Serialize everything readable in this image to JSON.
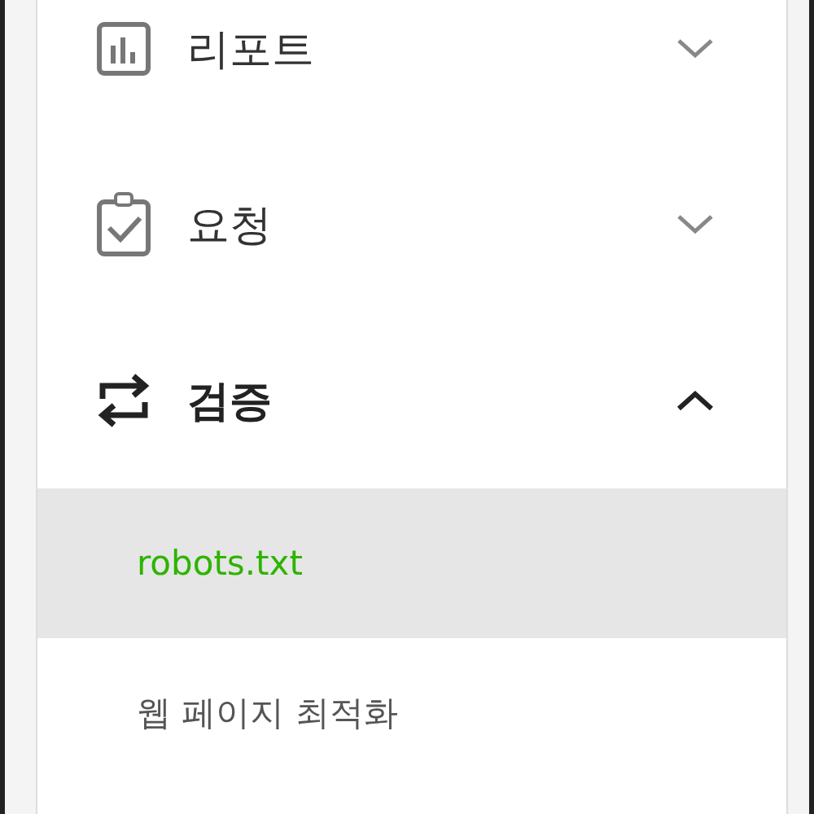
{
  "menu": [
    {
      "label": "리포트",
      "expanded": false
    },
    {
      "label": "요청",
      "expanded": false
    },
    {
      "label": "검증",
      "expanded": true,
      "children": [
        {
          "label": "robots.txt",
          "selected": true
        },
        {
          "label": "웹 페이지 최적화",
          "selected": false
        }
      ]
    }
  ]
}
